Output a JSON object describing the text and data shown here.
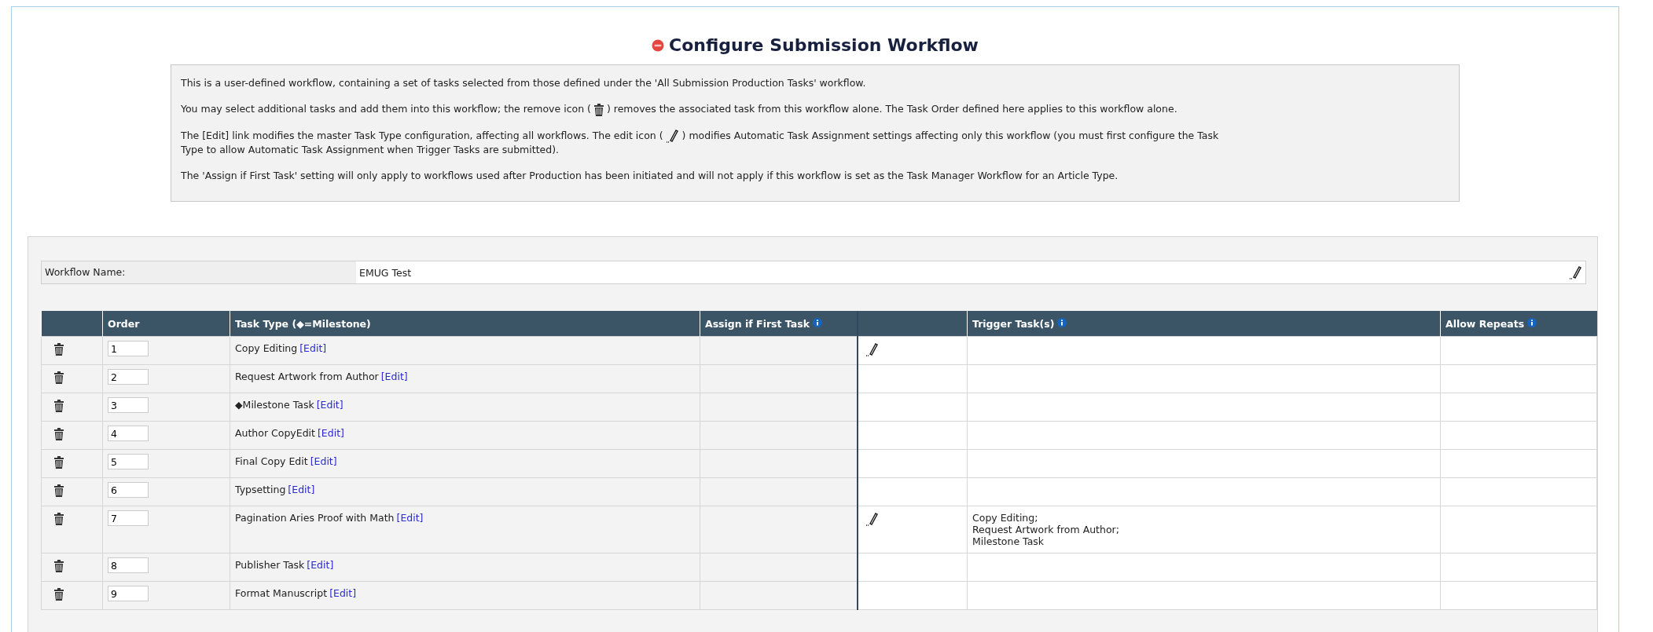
{
  "title": "Configure Submission Workflow",
  "info": [
    {
      "kind": "plain",
      "before": "This is a user-defined workflow, containing a set of tasks selected from those defined under the 'All Submission Production Tasks' workflow."
    },
    {
      "kind": "trash_note",
      "before": "You may select additional tasks and add them into this workflow; the remove icon (",
      "after": ") removes the associated task from this workflow alone. The Task Order defined here applies to this workflow alone."
    },
    {
      "kind": "edit_note",
      "before": "The [Edit] link modifies the master Task Type configuration, affecting all workflows. The edit icon (",
      "after": ") modifies Automatic Task Assignment settings affecting only this workflow (you must first configure the Task",
      "after_line2": "Type to allow Automatic Task Assignment when Trigger Tasks are submitted)."
    },
    {
      "kind": "plain",
      "before": "The 'Assign if First Task' setting will only apply to workflows used after Production has been initiated and will not apply if this workflow is set as the Task Manager Workflow for an Article Type."
    }
  ],
  "workflow_name": {
    "label": "Workflow Name:",
    "value": "EMUG Test"
  },
  "columns": [
    {
      "label": "Order",
      "info": false
    },
    {
      "label": "Task Type (◆=Milestone)",
      "info": false
    },
    {
      "label": "Assign if First Task",
      "info": true
    },
    {
      "label": "Trigger Task(s)",
      "info": true
    },
    {
      "label": "Allow Repeats",
      "info": true
    }
  ],
  "rows": [
    {
      "order": "1",
      "task": "Copy Editing",
      "edit_link": "[Edit]",
      "auto_edit": true,
      "triggers": []
    },
    {
      "order": "2",
      "task": "Request Artwork from Author",
      "edit_link": "[Edit]",
      "auto_edit": false,
      "triggers": []
    },
    {
      "order": "3",
      "task": "◆Milestone Task",
      "edit_link": "[Edit]",
      "auto_edit": false,
      "triggers": []
    },
    {
      "order": "4",
      "task": "Author CopyEdit",
      "edit_link": "[Edit]",
      "auto_edit": false,
      "triggers": []
    },
    {
      "order": "5",
      "task": "Final Copy Edit",
      "edit_link": "[Edit]",
      "auto_edit": false,
      "triggers": []
    },
    {
      "order": "6",
      "task": "Typsetting",
      "edit_link": "[Edit]",
      "auto_edit": false,
      "triggers": []
    },
    {
      "order": "7",
      "task": "Pagination Aries Proof with Math",
      "edit_link": "[Edit]",
      "auto_edit": true,
      "triggers": [
        "Copy Editing;",
        "Request Artwork from Author;",
        "Milestone Task"
      ]
    },
    {
      "order": "8",
      "task": "Publisher Task",
      "edit_link": "[Edit]",
      "auto_edit": false,
      "triggers": []
    },
    {
      "order": "9",
      "task": "Format Manuscript",
      "edit_link": "[Edit]",
      "auto_edit": false,
      "triggers": []
    }
  ]
}
